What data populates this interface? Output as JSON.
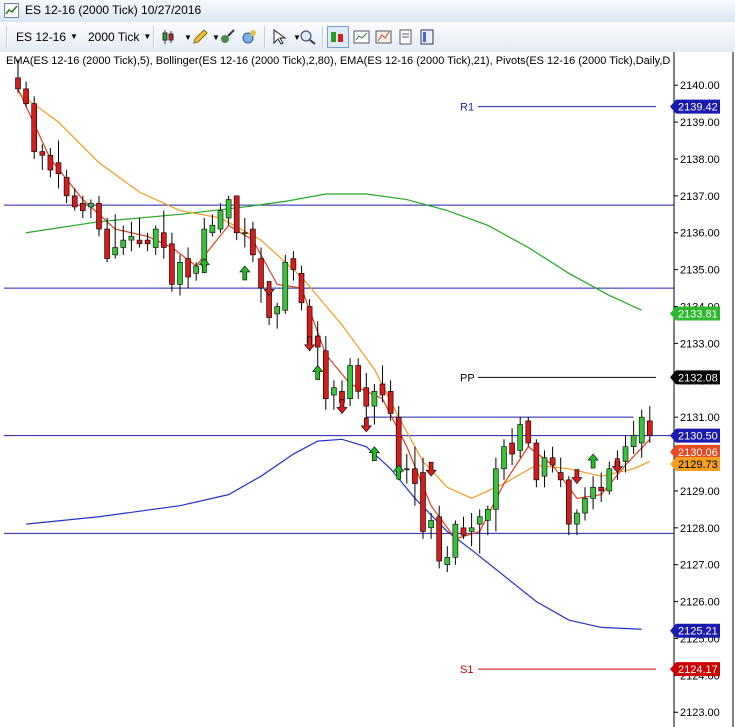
{
  "window": {
    "title": "ES 12-16 (2000 Tick)  10/27/2016"
  },
  "toolbar": {
    "instrument": "ES 12-16",
    "interval": "2000 Tick",
    "icons": [
      "bar-type-icon",
      "pencil-icon",
      "indicators-icon",
      "strategy-icon",
      "cursor-icon",
      "zoom-icon",
      "chart-trader-icon",
      "data-box-icon",
      "chart-style-icon",
      "properties-icon",
      "templates-icon"
    ]
  },
  "chart_data": {
    "type": "candlestick",
    "info_line": "EMA(ES 12-16 (2000 Tick),5), Bollinger(ES 12-16 (2000 Tick),2,80), EMA(ES 12-16 (2000 Tick),21), Pivots(ES 12-16 (2000 Tick),Daily,D",
    "ylim": [
      2122.6,
      2140.9
    ],
    "y_ticks": [
      2123,
      2124,
      2125,
      2126,
      2127,
      2128,
      2129,
      2130,
      2131,
      2132,
      2133,
      2134,
      2135,
      2136,
      2137,
      2138,
      2139,
      2140
    ],
    "candles": [
      {
        "o": 2140.2,
        "h": 2140.7,
        "l": 2139.8,
        "c": 2139.9
      },
      {
        "o": 2139.9,
        "h": 2140.1,
        "l": 2139.4,
        "c": 2139.5
      },
      {
        "o": 2139.5,
        "h": 2139.7,
        "l": 2138.0,
        "c": 2138.2
      },
      {
        "o": 2138.2,
        "h": 2138.4,
        "l": 2137.7,
        "c": 2138.1
      },
      {
        "o": 2138.1,
        "h": 2138.3,
        "l": 2137.5,
        "c": 2137.7
      },
      {
        "o": 2137.9,
        "h": 2138.5,
        "l": 2137.2,
        "c": 2137.6
      },
      {
        "o": 2137.5,
        "h": 2137.7,
        "l": 2136.8,
        "c": 2137.0
      },
      {
        "o": 2137.0,
        "h": 2137.2,
        "l": 2136.6,
        "c": 2136.7
      },
      {
        "o": 2136.8,
        "h": 2137.0,
        "l": 2136.4,
        "c": 2136.6
      },
      {
        "o": 2136.7,
        "h": 2136.9,
        "l": 2136.4,
        "c": 2136.8
      },
      {
        "o": 2136.8,
        "h": 2137.0,
        "l": 2135.9,
        "c": 2136.1
      },
      {
        "o": 2136.1,
        "h": 2136.4,
        "l": 2135.2,
        "c": 2135.3
      },
      {
        "o": 2135.4,
        "h": 2136.5,
        "l": 2135.3,
        "c": 2135.6
      },
      {
        "o": 2135.6,
        "h": 2136.2,
        "l": 2135.4,
        "c": 2135.8
      },
      {
        "o": 2135.8,
        "h": 2136.3,
        "l": 2135.5,
        "c": 2135.9
      },
      {
        "o": 2135.8,
        "h": 2136.4,
        "l": 2135.6,
        "c": 2135.7
      },
      {
        "o": 2135.8,
        "h": 2136.0,
        "l": 2135.5,
        "c": 2135.7
      },
      {
        "o": 2135.6,
        "h": 2136.2,
        "l": 2135.4,
        "c": 2136.1
      },
      {
        "o": 2136.0,
        "h": 2136.6,
        "l": 2135.3,
        "c": 2135.6
      },
      {
        "o": 2135.7,
        "h": 2136.0,
        "l": 2134.4,
        "c": 2134.6
      },
      {
        "o": 2134.6,
        "h": 2135.4,
        "l": 2134.3,
        "c": 2135.2
      },
      {
        "o": 2135.3,
        "h": 2135.6,
        "l": 2134.5,
        "c": 2134.8
      },
      {
        "o": 2134.9,
        "h": 2135.2,
        "l": 2134.7,
        "c": 2135.1
      },
      {
        "o": 2135.1,
        "h": 2136.4,
        "l": 2134.9,
        "c": 2136.1
      },
      {
        "o": 2136.0,
        "h": 2136.5,
        "l": 2135.9,
        "c": 2136.2
      },
      {
        "o": 2136.1,
        "h": 2136.8,
        "l": 2136.0,
        "c": 2136.6
      },
      {
        "o": 2136.4,
        "h": 2137.0,
        "l": 2136.2,
        "c": 2136.9
      },
      {
        "o": 2137.0,
        "h": 2137.0,
        "l": 2135.8,
        "c": 2136.0
      },
      {
        "o": 2136.0,
        "h": 2136.4,
        "l": 2135.6,
        "c": 2136.0
      },
      {
        "o": 2136.1,
        "h": 2136.3,
        "l": 2135.2,
        "c": 2135.4
      },
      {
        "o": 2135.3,
        "h": 2135.6,
        "l": 2134.1,
        "c": 2134.5
      },
      {
        "o": 2134.4,
        "h": 2134.6,
        "l": 2133.5,
        "c": 2133.7
      },
      {
        "o": 2133.8,
        "h": 2134.1,
        "l": 2133.4,
        "c": 2134.0
      },
      {
        "o": 2133.9,
        "h": 2135.4,
        "l": 2133.8,
        "c": 2135.2
      },
      {
        "o": 2135.3,
        "h": 2135.5,
        "l": 2134.7,
        "c": 2135.0
      },
      {
        "o": 2134.9,
        "h": 2135.1,
        "l": 2133.9,
        "c": 2134.1
      },
      {
        "o": 2134.0,
        "h": 2134.2,
        "l": 2132.8,
        "c": 2133.0
      },
      {
        "o": 2133.2,
        "h": 2133.6,
        "l": 2132.4,
        "c": 2132.9
      },
      {
        "o": 2132.8,
        "h": 2133.2,
        "l": 2131.2,
        "c": 2131.5
      },
      {
        "o": 2131.6,
        "h": 2132.0,
        "l": 2131.2,
        "c": 2131.8
      },
      {
        "o": 2131.7,
        "h": 2132.0,
        "l": 2131.1,
        "c": 2131.4
      },
      {
        "o": 2131.5,
        "h": 2132.6,
        "l": 2131.3,
        "c": 2132.4
      },
      {
        "o": 2132.4,
        "h": 2132.6,
        "l": 2131.5,
        "c": 2131.7
      },
      {
        "o": 2131.8,
        "h": 2132.2,
        "l": 2130.9,
        "c": 2131.3
      },
      {
        "o": 2131.3,
        "h": 2131.9,
        "l": 2130.8,
        "c": 2131.7
      },
      {
        "o": 2131.9,
        "h": 2132.4,
        "l": 2131.4,
        "c": 2131.6
      },
      {
        "o": 2131.7,
        "h": 2132.0,
        "l": 2130.9,
        "c": 2131.1
      },
      {
        "o": 2131.0,
        "h": 2131.3,
        "l": 2129.3,
        "c": 2129.5
      },
      {
        "o": 2129.6,
        "h": 2130.0,
        "l": 2129.2,
        "c": 2129.6
      },
      {
        "o": 2129.6,
        "h": 2130.2,
        "l": 2128.6,
        "c": 2129.2
      },
      {
        "o": 2129.5,
        "h": 2129.9,
        "l": 2127.7,
        "c": 2127.9
      },
      {
        "o": 2128.0,
        "h": 2128.4,
        "l": 2127.7,
        "c": 2128.2
      },
      {
        "o": 2128.3,
        "h": 2128.6,
        "l": 2126.9,
        "c": 2127.1
      },
      {
        "o": 2127.0,
        "h": 2127.5,
        "l": 2126.8,
        "c": 2127.2
      },
      {
        "o": 2127.2,
        "h": 2128.2,
        "l": 2127.0,
        "c": 2128.1
      },
      {
        "o": 2128.0,
        "h": 2128.3,
        "l": 2127.7,
        "c": 2127.8
      },
      {
        "o": 2127.9,
        "h": 2128.4,
        "l": 2127.5,
        "c": 2128.0
      },
      {
        "o": 2128.1,
        "h": 2128.5,
        "l": 2127.3,
        "c": 2128.3
      },
      {
        "o": 2128.2,
        "h": 2128.6,
        "l": 2127.8,
        "c": 2128.5
      },
      {
        "o": 2128.5,
        "h": 2129.9,
        "l": 2127.9,
        "c": 2129.6
      },
      {
        "o": 2129.6,
        "h": 2130.4,
        "l": 2129.3,
        "c": 2130.2
      },
      {
        "o": 2130.3,
        "h": 2130.7,
        "l": 2129.7,
        "c": 2130.0
      },
      {
        "o": 2130.1,
        "h": 2131.0,
        "l": 2129.9,
        "c": 2130.8
      },
      {
        "o": 2130.9,
        "h": 2131.0,
        "l": 2130.2,
        "c": 2130.3
      },
      {
        "o": 2130.3,
        "h": 2130.4,
        "l": 2129.1,
        "c": 2129.3
      },
      {
        "o": 2129.4,
        "h": 2130.1,
        "l": 2129.1,
        "c": 2129.9
      },
      {
        "o": 2129.9,
        "h": 2130.2,
        "l": 2129.5,
        "c": 2129.7
      },
      {
        "o": 2129.5,
        "h": 2129.9,
        "l": 2129.1,
        "c": 2129.3
      },
      {
        "o": 2129.3,
        "h": 2129.4,
        "l": 2127.8,
        "c": 2128.1
      },
      {
        "o": 2128.1,
        "h": 2128.5,
        "l": 2127.8,
        "c": 2128.4
      },
      {
        "o": 2128.4,
        "h": 2129.1,
        "l": 2128.2,
        "c": 2128.8
      },
      {
        "o": 2128.8,
        "h": 2129.4,
        "l": 2128.5,
        "c": 2129.1
      },
      {
        "o": 2129.1,
        "h": 2129.5,
        "l": 2128.7,
        "c": 2129.0
      },
      {
        "o": 2129.0,
        "h": 2129.8,
        "l": 2128.9,
        "c": 2129.6
      },
      {
        "o": 2129.6,
        "h": 2130.1,
        "l": 2129.3,
        "c": 2129.8
      },
      {
        "o": 2129.8,
        "h": 2130.5,
        "l": 2129.5,
        "c": 2130.2
      },
      {
        "o": 2130.2,
        "h": 2130.9,
        "l": 2130.0,
        "c": 2130.5
      },
      {
        "o": 2130.3,
        "h": 2131.2,
        "l": 2129.9,
        "c": 2131.0
      },
      {
        "o": 2130.9,
        "h": 2131.3,
        "l": 2130.3,
        "c": 2130.5
      }
    ],
    "lines": [
      {
        "name": "Bollinger Upper",
        "color": "#22aa22",
        "points": [
          [
            1,
            2136.0
          ],
          [
            10,
            2136.3
          ],
          [
            20,
            2136.5
          ],
          [
            28,
            2136.7
          ],
          [
            33,
            2136.85
          ],
          [
            38,
            2137.05
          ],
          [
            43,
            2137.05
          ],
          [
            48,
            2136.9
          ],
          [
            53,
            2136.6
          ],
          [
            58,
            2136.2
          ],
          [
            63,
            2135.6
          ],
          [
            68,
            2134.9
          ],
          [
            73,
            2134.3
          ],
          [
            77,
            2133.9
          ]
        ]
      },
      {
        "name": "Bollinger Lower",
        "color": "#2233cc",
        "points": [
          [
            1,
            2128.1
          ],
          [
            10,
            2128.3
          ],
          [
            20,
            2128.6
          ],
          [
            26,
            2128.9
          ],
          [
            30,
            2129.4
          ],
          [
            34,
            2130.0
          ],
          [
            37,
            2130.35
          ],
          [
            40,
            2130.4
          ],
          [
            43,
            2130.2
          ],
          [
            46,
            2129.6
          ],
          [
            49,
            2128.8
          ],
          [
            53,
            2127.9
          ],
          [
            56,
            2127.4
          ],
          [
            60,
            2126.7
          ],
          [
            64,
            2126.0
          ],
          [
            68,
            2125.5
          ],
          [
            72,
            2125.3
          ],
          [
            77,
            2125.25
          ]
        ]
      },
      {
        "name": "EMA 21",
        "color": "#f59a1e",
        "points": [
          [
            0,
            2139.8
          ],
          [
            5,
            2139.0
          ],
          [
            10,
            2137.9
          ],
          [
            15,
            2137.1
          ],
          [
            20,
            2136.6
          ],
          [
            25,
            2136.4
          ],
          [
            30,
            2135.8
          ],
          [
            35,
            2134.8
          ],
          [
            40,
            2133.5
          ],
          [
            44,
            2132.3
          ],
          [
            47,
            2131.0
          ],
          [
            50,
            2129.8
          ],
          [
            53,
            2129.1
          ],
          [
            56,
            2128.8
          ],
          [
            60,
            2129.2
          ],
          [
            64,
            2129.7
          ],
          [
            68,
            2129.6
          ],
          [
            72,
            2129.4
          ],
          [
            76,
            2129.6
          ],
          [
            78,
            2129.8
          ]
        ]
      },
      {
        "name": "EMA 5",
        "color": "#e04020",
        "points": [
          [
            0,
            2139.9
          ],
          [
            4,
            2138.0
          ],
          [
            8,
            2136.9
          ],
          [
            12,
            2136.1
          ],
          [
            16,
            2135.9
          ],
          [
            19,
            2135.6
          ],
          [
            22,
            2135.1
          ],
          [
            26,
            2136.2
          ],
          [
            29,
            2135.8
          ],
          [
            32,
            2134.6
          ],
          [
            35,
            2134.5
          ],
          [
            38,
            2132.7
          ],
          [
            41,
            2131.9
          ],
          [
            45,
            2131.5
          ],
          [
            48,
            2130.2
          ],
          [
            51,
            2128.6
          ],
          [
            54,
            2127.7
          ],
          [
            57,
            2127.9
          ],
          [
            60,
            2129.2
          ],
          [
            63,
            2130.2
          ],
          [
            66,
            2129.7
          ],
          [
            69,
            2128.8
          ],
          [
            72,
            2128.9
          ],
          [
            75,
            2129.7
          ],
          [
            78,
            2130.4
          ]
        ]
      }
    ],
    "h_lines": [
      {
        "y": 2136.75,
        "color": "#1e1ea8"
      },
      {
        "y": 2134.5,
        "color": "#1e1ea8"
      },
      {
        "y": 2130.5,
        "color": "#1e1ea8"
      },
      {
        "y": 2127.85,
        "color": "#1e1ea8"
      },
      {
        "y": 2131.0,
        "color": "#1e1ea8",
        "from": 43,
        "to": 76
      }
    ],
    "pivots": [
      {
        "label": "R1",
        "y": 2139.42,
        "color": "#1e1ea8"
      },
      {
        "label": "PP",
        "y": 2132.08,
        "color": "#000000"
      },
      {
        "label": "S1",
        "y": 2124.17,
        "color": "#cc0000"
      }
    ],
    "arrows": [
      {
        "i": 31,
        "dir": "down",
        "y": 2134.3
      },
      {
        "i": 36,
        "dir": "down",
        "y": 2132.8
      },
      {
        "i": 40,
        "dir": "down",
        "y": 2131.1
      },
      {
        "i": 43,
        "dir": "down",
        "y": 2130.6
      },
      {
        "i": 51,
        "dir": "down",
        "y": 2129.4
      },
      {
        "i": 69,
        "dir": "down",
        "y": 2129.2
      },
      {
        "i": 74,
        "dir": "down",
        "y": 2129.5
      },
      {
        "i": 23,
        "dir": "up",
        "y": 2135.3
      },
      {
        "i": 28,
        "dir": "up",
        "y": 2135.1
      },
      {
        "i": 37,
        "dir": "up",
        "y": 2132.4
      },
      {
        "i": 44,
        "dir": "up",
        "y": 2130.2
      },
      {
        "i": 47,
        "dir": "up",
        "y": 2129.7
      },
      {
        "i": 71,
        "dir": "up",
        "y": 2130.0
      }
    ],
    "price_labels": [
      {
        "text": "2139.42",
        "y": 2139.42,
        "bg": "#1a1ab0",
        "fg": "#ffffff"
      },
      {
        "text": "2133.81",
        "y": 2133.81,
        "bg": "#2db82d",
        "fg": "#ffffff"
      },
      {
        "text": "2132.08",
        "y": 2132.08,
        "bg": "#000000",
        "fg": "#ffffff"
      },
      {
        "text": "2130.50",
        "y": 2130.5,
        "bg": "#1a1ab0",
        "fg": "#ffffff"
      },
      {
        "text": "2130.06",
        "y": 2130.06,
        "bg": "#e84a22",
        "fg": "#ffffff"
      },
      {
        "text": "2129.73",
        "y": 2129.73,
        "bg": "#f5a020",
        "fg": "#000000"
      },
      {
        "text": "2125.21",
        "y": 2125.21,
        "bg": "#1a1ab0",
        "fg": "#ffffff"
      },
      {
        "text": "2124.17",
        "y": 2124.17,
        "bg": "#cc0000",
        "fg": "#ffffff"
      }
    ]
  }
}
